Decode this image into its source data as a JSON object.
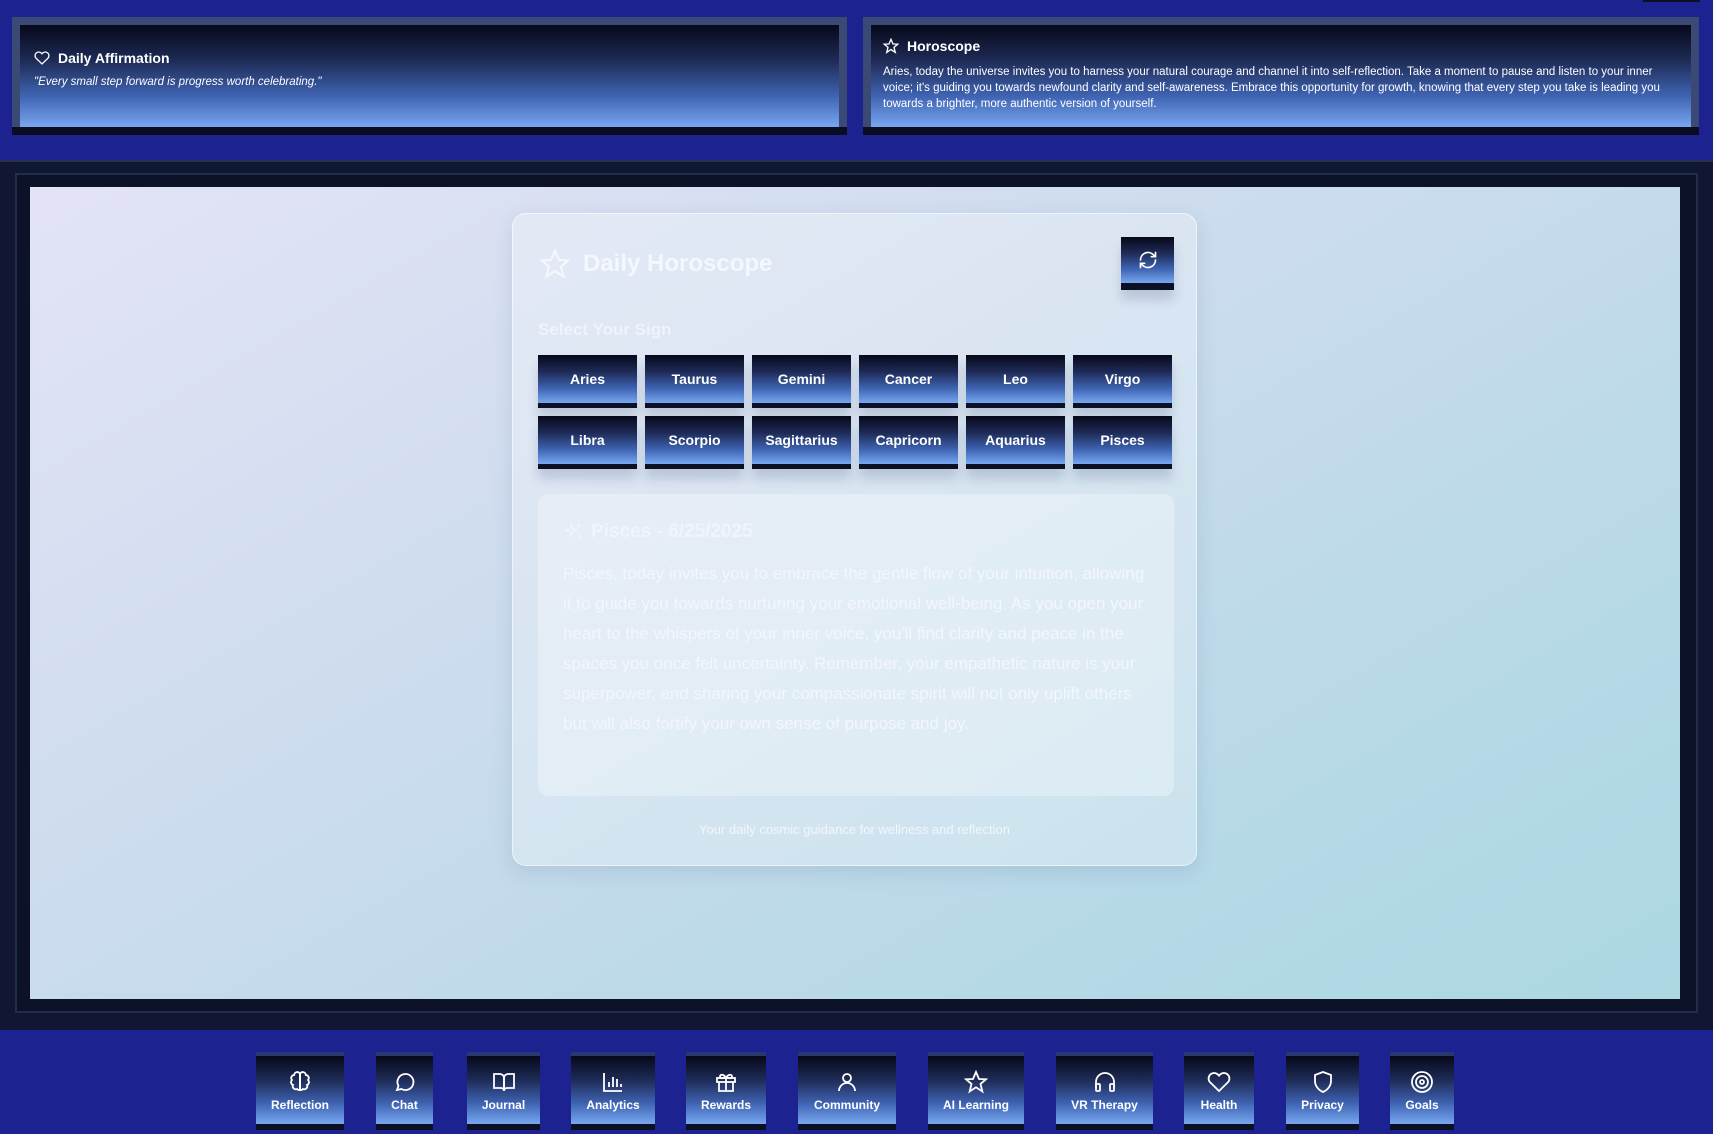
{
  "affirmation": {
    "title": "Daily Affirmation",
    "text": "\"Every small step forward is progress worth celebrating.\""
  },
  "horoscope_banner": {
    "title": "Horoscope",
    "text": "Aries, today the universe invites you to harness your natural courage and channel it into self-reflection. Take a moment to pause and listen to your inner voice; it's guiding you towards newfound clarity and self-awareness. Embrace this opportunity for growth, knowing that every step you take is leading you towards a brighter, more authentic version of yourself."
  },
  "card": {
    "title": "Daily Horoscope",
    "select_label": "Select Your Sign",
    "signs": [
      "Aries",
      "Taurus",
      "Gemini",
      "Cancer",
      "Leo",
      "Virgo",
      "Libra",
      "Scorpio",
      "Sagittarius",
      "Capricorn",
      "Aquarius",
      "Pisces"
    ],
    "reading_title": "Pisces - 6/25/2025",
    "reading_text": "Pisces, today invites you to embrace the gentle flow of your intuition, allowing it to guide you towards nurturing your emotional well-being. As you open your heart to the whispers of your inner voice, you'll find clarity and peace in the spaces you once felt uncertainty. Remember, your empathetic nature is your superpower, and sharing your compassionate spirit will not only uplift others but will also fortify your own sense of purpose and joy.",
    "footer": "Your daily cosmic guidance for wellness and reflection",
    "refresh_icon": "refresh-icon"
  },
  "nav": [
    {
      "label": "Reflection",
      "icon": "brain-icon"
    },
    {
      "label": "Chat",
      "icon": "chat-icon"
    },
    {
      "label": "Journal",
      "icon": "book-icon"
    },
    {
      "label": "Analytics",
      "icon": "bar-chart-icon"
    },
    {
      "label": "Rewards",
      "icon": "gift-icon"
    },
    {
      "label": "Community",
      "icon": "user-icon"
    },
    {
      "label": "AI Learning",
      "icon": "star-icon"
    },
    {
      "label": "VR Therapy",
      "icon": "headphones-icon"
    },
    {
      "label": "Health",
      "icon": "heart-icon"
    },
    {
      "label": "Privacy",
      "icon": "shield-icon"
    },
    {
      "label": "Goals",
      "icon": "target-icon"
    }
  ],
  "colors": {
    "background": "#1c2390",
    "button_gradient_top": "#07091a",
    "button_gradient_bottom": "#78a7f0"
  }
}
